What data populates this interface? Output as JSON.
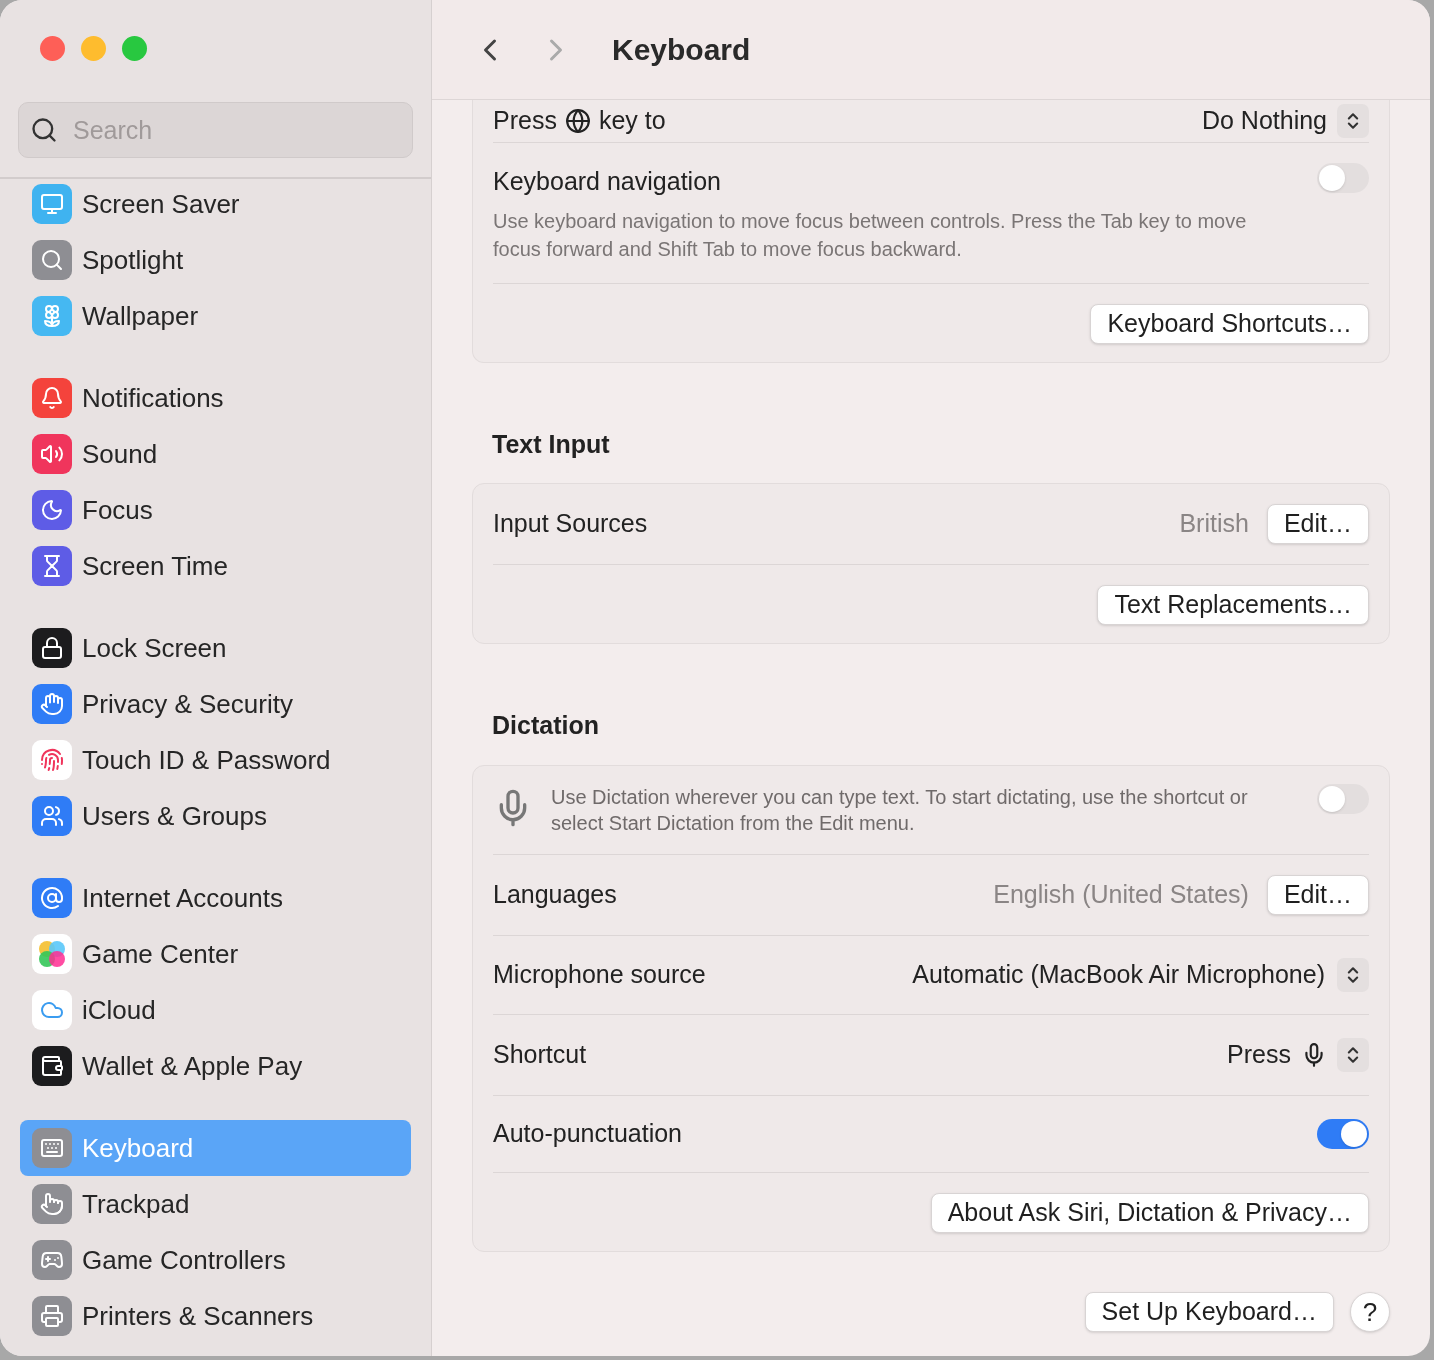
{
  "sidebar": {
    "search": {
      "placeholder": "Search"
    },
    "groups": [
      [
        {
          "label": "Screen Saver",
          "selected": false
        },
        {
          "label": "Spotlight",
          "selected": false
        },
        {
          "label": "Wallpaper",
          "selected": false
        }
      ],
      [
        {
          "label": "Notifications",
          "selected": false
        },
        {
          "label": "Sound",
          "selected": false
        },
        {
          "label": "Focus",
          "selected": false
        },
        {
          "label": "Screen Time",
          "selected": false
        }
      ],
      [
        {
          "label": "Lock Screen",
          "selected": false
        },
        {
          "label": "Privacy & Security",
          "selected": false
        },
        {
          "label": "Touch ID & Password",
          "selected": false
        },
        {
          "label": "Users & Groups",
          "selected": false
        }
      ],
      [
        {
          "label": "Internet Accounts",
          "selected": false
        },
        {
          "label": "Game Center",
          "selected": false
        },
        {
          "label": "iCloud",
          "selected": false
        },
        {
          "label": "Wallet & Apple Pay",
          "selected": false
        }
      ],
      [
        {
          "label": "Keyboard",
          "selected": true
        },
        {
          "label": "Trackpad",
          "selected": false
        },
        {
          "label": "Game Controllers",
          "selected": false
        },
        {
          "label": "Printers & Scanners",
          "selected": false
        }
      ]
    ]
  },
  "header": {
    "title": "Keyboard"
  },
  "keyboard_section": {
    "globe_row": {
      "label_before": "Press",
      "label_after": "key to",
      "value": "Do Nothing"
    },
    "navigation": {
      "label": "Keyboard navigation",
      "description": "Use keyboard navigation to move focus between controls. Press the Tab key to move focus forward and Shift Tab to move focus backward.",
      "on": false
    },
    "button": "Keyboard Shortcuts…"
  },
  "text_input": {
    "heading": "Text Input",
    "input_sources": {
      "label": "Input Sources",
      "value": "British",
      "button": "Edit…"
    },
    "button": "Text Replacements…"
  },
  "dictation": {
    "heading": "Dictation",
    "description": "Use Dictation wherever you can type text. To start dictating, use the shortcut or select Start Dictation from the Edit menu.",
    "on": false,
    "languages": {
      "label": "Languages",
      "value": "English (United States)",
      "button": "Edit…"
    },
    "microphone_source": {
      "label": "Microphone source",
      "value": "Automatic (MacBook Air Microphone)"
    },
    "shortcut": {
      "label": "Shortcut",
      "value": "Press"
    },
    "auto_punctuation": {
      "label": "Auto-punctuation",
      "on": true
    },
    "button": "About Ask Siri, Dictation & Privacy…"
  },
  "footer": {
    "setup_button": "Set Up Keyboard…",
    "help_button": "?"
  }
}
